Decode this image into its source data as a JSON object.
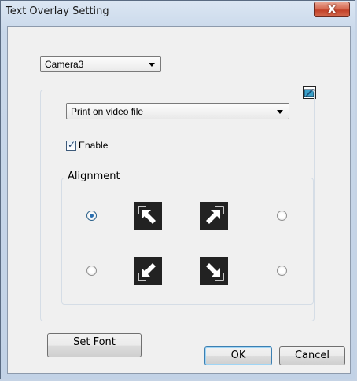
{
  "window": {
    "title": "Text Overlay Setting",
    "close_label": "X"
  },
  "camera_select": {
    "selected": "Camera3"
  },
  "output_select": {
    "selected": "Print on video file"
  },
  "enable_checkbox": {
    "label": "Enable",
    "checked": true
  },
  "alignment": {
    "legend": "Alignment",
    "options": [
      {
        "position": "top-left",
        "selected": true
      },
      {
        "position": "top-right",
        "selected": false
      },
      {
        "position": "bottom-left",
        "selected": false
      },
      {
        "position": "bottom-right",
        "selected": false
      }
    ]
  },
  "buttons": {
    "set_font": "Set Font",
    "ok": "OK",
    "cancel": "Cancel"
  },
  "icons": [
    "close-icon",
    "settings-icon",
    "arrow-top-left-icon",
    "arrow-top-right-icon",
    "arrow-bottom-left-icon",
    "arrow-bottom-right-icon"
  ]
}
